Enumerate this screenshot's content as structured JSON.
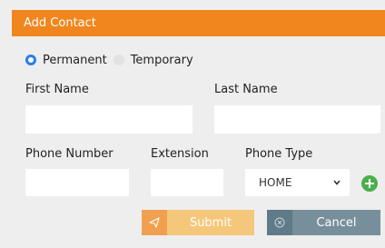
{
  "dialog": {
    "title": "Add Contact"
  },
  "address_type": {
    "options": [
      {
        "label": "Permanent",
        "selected": true
      },
      {
        "label": "Temporary",
        "selected": false
      }
    ]
  },
  "form": {
    "first_name": {
      "label": "First Name",
      "value": ""
    },
    "last_name": {
      "label": "Last Name",
      "value": ""
    },
    "phone_number": {
      "label": "Phone Number",
      "value": ""
    },
    "extension": {
      "label": "Extension",
      "value": ""
    },
    "phone_type": {
      "label": "Phone Type",
      "selected": "HOME"
    }
  },
  "actions": {
    "add_icon": "plus-circle-icon",
    "submit_label": "Submit",
    "submit_icon": "send-icon",
    "cancel_label": "Cancel",
    "cancel_icon": "cancel-circle-icon"
  },
  "colors": {
    "title_bar": "#f0861d",
    "radio_checked": "#2b7de9",
    "add_button": "#4cae4c",
    "submit": "#f5c77a",
    "cancel": "#778f9b"
  }
}
